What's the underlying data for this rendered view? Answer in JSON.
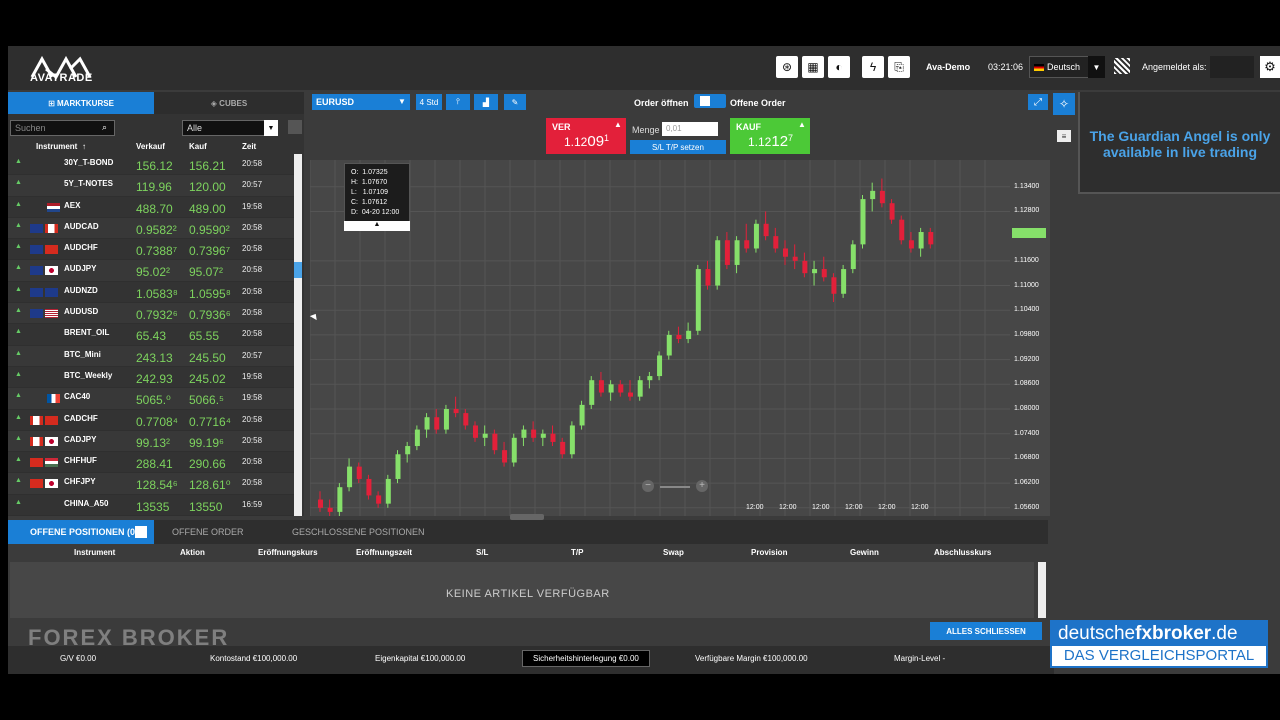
{
  "header": {
    "logo_text": "AVATRADE",
    "account": "Ava-Demo",
    "clock": "03:21:06",
    "language": "Deutsch",
    "logged_in_label": "Angemeldet als:"
  },
  "left_panel": {
    "tab_active": "MARKTKURSE",
    "tab_inactive": "CUBES",
    "search_placeholder": "Suchen",
    "filter_value": "Alle",
    "columns": [
      "Instrument",
      "Verkauf",
      "Kauf",
      "Zeit"
    ],
    "rows": [
      {
        "name": "30Y_T-BOND",
        "flags": [],
        "sell": "156.12",
        "buy": "156.21",
        "time": "20:58"
      },
      {
        "name": "5Y_T-NOTES",
        "flags": [],
        "sell": "119.96",
        "buy": "120.00",
        "time": "20:57"
      },
      {
        "name": "AEX",
        "flags": [
          "nl"
        ],
        "sell": "488.70",
        "buy": "489.00",
        "time": "19:58"
      },
      {
        "name": "AUDCAD",
        "flags": [
          "au",
          "ca"
        ],
        "sell": "0.9582²",
        "buy": "0.9590²",
        "time": "20:58"
      },
      {
        "name": "AUDCHF",
        "flags": [
          "au",
          "ch"
        ],
        "sell": "0.7388⁷",
        "buy": "0.7396⁷",
        "time": "20:58"
      },
      {
        "name": "AUDJPY",
        "flags": [
          "au",
          "jp"
        ],
        "sell": "95.02²",
        "buy": "95.07²",
        "time": "20:58"
      },
      {
        "name": "AUDNZD",
        "flags": [
          "au",
          "nz"
        ],
        "sell": "1.0583⁸",
        "buy": "1.0595⁸",
        "time": "20:58"
      },
      {
        "name": "AUDUSD",
        "flags": [
          "au",
          "us"
        ],
        "sell": "0.7932⁶",
        "buy": "0.7936⁶",
        "time": "20:58"
      },
      {
        "name": "BRENT_OIL",
        "flags": [],
        "sell": "65.43",
        "buy": "65.55",
        "time": "20:58"
      },
      {
        "name": "BTC_Mini",
        "flags": [],
        "sell": "243.13",
        "buy": "245.50",
        "time": "20:57"
      },
      {
        "name": "BTC_Weekly",
        "flags": [],
        "sell": "242.93",
        "buy": "245.02",
        "time": "19:58"
      },
      {
        "name": "CAC40",
        "flags": [
          "fr"
        ],
        "sell": "5065.⁰",
        "buy": "5066.⁵",
        "time": "19:58"
      },
      {
        "name": "CADCHF",
        "flags": [
          "ca",
          "ch"
        ],
        "sell": "0.7708⁴",
        "buy": "0.7716⁴",
        "time": "20:58"
      },
      {
        "name": "CADJPY",
        "flags": [
          "ca",
          "jp"
        ],
        "sell": "99.13²",
        "buy": "99.19⁶",
        "time": "20:58"
      },
      {
        "name": "CHFHUF",
        "flags": [
          "ch",
          "hu"
        ],
        "sell": "288.41",
        "buy": "290.66",
        "time": "20:58"
      },
      {
        "name": "CHFJPY",
        "flags": [
          "ch",
          "jp"
        ],
        "sell": "128.54⁶",
        "buy": "128.61⁰",
        "time": "20:58"
      },
      {
        "name": "CHINA_A50",
        "flags": [],
        "sell": "13535",
        "buy": "13550",
        "time": "16:59"
      }
    ]
  },
  "toolbar": {
    "instrument": "EURUSD",
    "timeframe": "4 Std",
    "order_open": "Order öffnen",
    "pending_order": "Offene Order"
  },
  "trade": {
    "sell_label": "VER",
    "sell_price_prefix": "1.12",
    "sell_price_big": "09",
    "sell_price_sup": "1",
    "buy_label": "KAUF",
    "buy_price_prefix": "1.12",
    "buy_price_big": "12",
    "buy_price_sup": "7",
    "amount_label": "Menge",
    "amount_placeholder": "0,01",
    "sltp_label": "S/L T/P setzen"
  },
  "chart_data": {
    "type": "candlestick",
    "ohlc_tooltip": {
      "O": "1.07325",
      "H": "1.07670",
      "L": "1.07109",
      "C": "1.07612",
      "D": "04-20 12:00"
    },
    "y_ticks": [
      "1.13400",
      "1.12800",
      "1.11600",
      "1.11000",
      "1.10400",
      "1.09800",
      "1.09200",
      "1.08600",
      "1.08000",
      "1.07400",
      "1.06800",
      "1.06200",
      "1.05600"
    ],
    "x_ticks": [
      "12:00",
      "12:00",
      "12:00",
      "12:00",
      "12:00",
      "12:00"
    ],
    "ylim": [
      1.054,
      1.1405
    ],
    "candles": [
      [
        1.058,
        1.06,
        1.055,
        1.056
      ],
      [
        1.056,
        1.058,
        1.054,
        1.055
      ],
      [
        1.055,
        1.062,
        1.054,
        1.061
      ],
      [
        1.061,
        1.068,
        1.06,
        1.066
      ],
      [
        1.066,
        1.067,
        1.062,
        1.063
      ],
      [
        1.063,
        1.064,
        1.058,
        1.059
      ],
      [
        1.059,
        1.06,
        1.056,
        1.057
      ],
      [
        1.057,
        1.064,
        1.056,
        1.063
      ],
      [
        1.063,
        1.07,
        1.062,
        1.069
      ],
      [
        1.069,
        1.072,
        1.067,
        1.071
      ],
      [
        1.071,
        1.076,
        1.07,
        1.075
      ],
      [
        1.075,
        1.079,
        1.073,
        1.078
      ],
      [
        1.078,
        1.08,
        1.074,
        1.075
      ],
      [
        1.075,
        1.081,
        1.074,
        1.08
      ],
      [
        1.08,
        1.083,
        1.078,
        1.079
      ],
      [
        1.079,
        1.08,
        1.075,
        1.076
      ],
      [
        1.076,
        1.077,
        1.072,
        1.073
      ],
      [
        1.073,
        1.076,
        1.071,
        1.074
      ],
      [
        1.074,
        1.075,
        1.069,
        1.07
      ],
      [
        1.07,
        1.072,
        1.066,
        1.067
      ],
      [
        1.067,
        1.074,
        1.066,
        1.073
      ],
      [
        1.073,
        1.076,
        1.071,
        1.075
      ],
      [
        1.075,
        1.077,
        1.072,
        1.073
      ],
      [
        1.073,
        1.075,
        1.071,
        1.074
      ],
      [
        1.074,
        1.076,
        1.071,
        1.072
      ],
      [
        1.072,
        1.073,
        1.068,
        1.069
      ],
      [
        1.069,
        1.077,
        1.068,
        1.076
      ],
      [
        1.076,
        1.082,
        1.075,
        1.081
      ],
      [
        1.081,
        1.088,
        1.08,
        1.087
      ],
      [
        1.087,
        1.089,
        1.083,
        1.084
      ],
      [
        1.084,
        1.087,
        1.082,
        1.086
      ],
      [
        1.086,
        1.087,
        1.083,
        1.084
      ],
      [
        1.084,
        1.087,
        1.082,
        1.083
      ],
      [
        1.083,
        1.088,
        1.082,
        1.087
      ],
      [
        1.087,
        1.089,
        1.085,
        1.088
      ],
      [
        1.088,
        1.094,
        1.087,
        1.093
      ],
      [
        1.093,
        1.099,
        1.092,
        1.098
      ],
      [
        1.098,
        1.1,
        1.096,
        1.097
      ],
      [
        1.097,
        1.101,
        1.096,
        1.099
      ],
      [
        1.099,
        1.115,
        1.098,
        1.114
      ],
      [
        1.114,
        1.116,
        1.109,
        1.11
      ],
      [
        1.11,
        1.122,
        1.109,
        1.121
      ],
      [
        1.121,
        1.123,
        1.114,
        1.115
      ],
      [
        1.115,
        1.122,
        1.113,
        1.121
      ],
      [
        1.121,
        1.125,
        1.118,
        1.119
      ],
      [
        1.119,
        1.126,
        1.118,
        1.125
      ],
      [
        1.125,
        1.128,
        1.121,
        1.122
      ],
      [
        1.122,
        1.124,
        1.118,
        1.119
      ],
      [
        1.119,
        1.121,
        1.115,
        1.117
      ],
      [
        1.117,
        1.12,
        1.114,
        1.116
      ],
      [
        1.116,
        1.118,
        1.112,
        1.113
      ],
      [
        1.113,
        1.116,
        1.11,
        1.114
      ],
      [
        1.114,
        1.117,
        1.111,
        1.112
      ],
      [
        1.112,
        1.113,
        1.106,
        1.108
      ],
      [
        1.108,
        1.115,
        1.107,
        1.114
      ],
      [
        1.114,
        1.121,
        1.113,
        1.12
      ],
      [
        1.12,
        1.132,
        1.119,
        1.131
      ],
      [
        1.131,
        1.135,
        1.128,
        1.133
      ],
      [
        1.133,
        1.136,
        1.129,
        1.13
      ],
      [
        1.13,
        1.131,
        1.125,
        1.126
      ],
      [
        1.126,
        1.127,
        1.12,
        1.121
      ],
      [
        1.121,
        1.123,
        1.118,
        1.119
      ],
      [
        1.119,
        1.124,
        1.117,
        1.123
      ],
      [
        1.123,
        1.124,
        1.119,
        1.12
      ]
    ]
  },
  "bottom": {
    "tabs": [
      "OFFENE POSITIONEN (0)",
      "OFFENE ORDER",
      "GESCHLOSSENE POSITIONEN"
    ],
    "columns": [
      "Instrument",
      "Aktion",
      "Eröffnungskurs",
      "Eröffnungszeit",
      "S/L",
      "T/P",
      "Swap",
      "Provision",
      "Gewinn",
      "Abschlusskurs"
    ],
    "empty_text": "KEINE ARTIKEL VERFÜGBAR",
    "close_all": "ALLES SCHLIESSEN"
  },
  "status": {
    "gv": "G/V €0.00",
    "balance": "Kontostand €100,000.00",
    "equity": "Eigenkapital €100,000.00",
    "margin_used": "Sicherheitshinterlegung €0.00",
    "margin_free": "Verfügbare Margin €100,000.00",
    "margin_level": "Margin-Level -"
  },
  "guardian": {
    "text": "The Guardian Angel is only available in live trading"
  },
  "ad": {
    "brand_pre": "deutsche",
    "brand_bold": "fxbroker",
    "brand_post": ".de",
    "tagline": "DAS VERGLEICHSPORTAL"
  },
  "watermark": "FOREX BROKER",
  "colors": {
    "accent": "#1a7fd6",
    "sell": "#e3203a",
    "buy": "#4cc937",
    "up": "#86e06a",
    "down": "#e3203a"
  }
}
